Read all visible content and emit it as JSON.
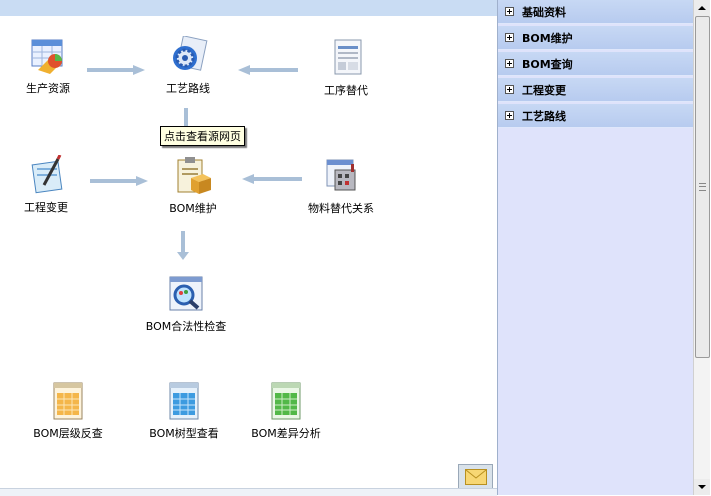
{
  "main": {
    "nodes": {
      "production_resource": "生产资源",
      "process_route": "工艺路线",
      "operation_substitute": "工序替代",
      "engineering_change": "工程变更",
      "bom_maintenance": "BOM维护",
      "material_substitute": "物料替代关系",
      "bom_validity_check": "BOM合法性检查",
      "bom_level_query": "BOM层级反查",
      "bom_tree_view": "BOM树型查看",
      "bom_diff_analysis": "BOM差异分析"
    },
    "tooltip": "点击查看源网页"
  },
  "sidebar": {
    "items": [
      {
        "label": "基础资料"
      },
      {
        "label": "BOM维护"
      },
      {
        "label": "BOM查询"
      },
      {
        "label": "工程变更"
      },
      {
        "label": "工艺路线"
      }
    ]
  },
  "colors": {
    "topbar": "#c9dcf3",
    "arrow": "#a9bfd7",
    "sidebar_bg": "#dfe3fb",
    "sidebar_item": "#bfd1f2",
    "tooltip_bg": "#ffffe1"
  },
  "icons": [
    "table-chart-icon",
    "gear-globe-icon",
    "document-icon",
    "pen-notepad-icon",
    "clipboard-box-icon",
    "factory-icon",
    "magnifier-icon",
    "spreadsheet-icon",
    "mail-icon"
  ]
}
